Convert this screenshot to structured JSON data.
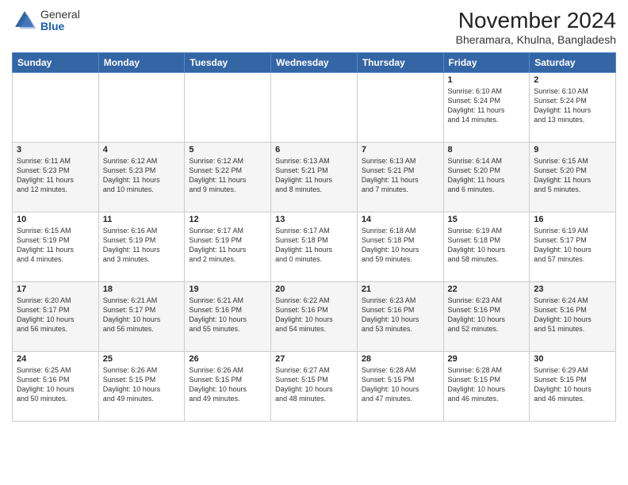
{
  "logo": {
    "general": "General",
    "blue": "Blue"
  },
  "title": "November 2024",
  "subtitle": "Bheramara, Khulna, Bangladesh",
  "weekdays": [
    "Sunday",
    "Monday",
    "Tuesday",
    "Wednesday",
    "Thursday",
    "Friday",
    "Saturday"
  ],
  "weeks": [
    [
      {
        "day": "",
        "info": ""
      },
      {
        "day": "",
        "info": ""
      },
      {
        "day": "",
        "info": ""
      },
      {
        "day": "",
        "info": ""
      },
      {
        "day": "",
        "info": ""
      },
      {
        "day": "1",
        "info": "Sunrise: 6:10 AM\nSunset: 5:24 PM\nDaylight: 11 hours\nand 14 minutes."
      },
      {
        "day": "2",
        "info": "Sunrise: 6:10 AM\nSunset: 5:24 PM\nDaylight: 11 hours\nand 13 minutes."
      }
    ],
    [
      {
        "day": "3",
        "info": "Sunrise: 6:11 AM\nSunset: 5:23 PM\nDaylight: 11 hours\nand 12 minutes."
      },
      {
        "day": "4",
        "info": "Sunrise: 6:12 AM\nSunset: 5:23 PM\nDaylight: 11 hours\nand 10 minutes."
      },
      {
        "day": "5",
        "info": "Sunrise: 6:12 AM\nSunset: 5:22 PM\nDaylight: 11 hours\nand 9 minutes."
      },
      {
        "day": "6",
        "info": "Sunrise: 6:13 AM\nSunset: 5:21 PM\nDaylight: 11 hours\nand 8 minutes."
      },
      {
        "day": "7",
        "info": "Sunrise: 6:13 AM\nSunset: 5:21 PM\nDaylight: 11 hours\nand 7 minutes."
      },
      {
        "day": "8",
        "info": "Sunrise: 6:14 AM\nSunset: 5:20 PM\nDaylight: 11 hours\nand 6 minutes."
      },
      {
        "day": "9",
        "info": "Sunrise: 6:15 AM\nSunset: 5:20 PM\nDaylight: 11 hours\nand 5 minutes."
      }
    ],
    [
      {
        "day": "10",
        "info": "Sunrise: 6:15 AM\nSunset: 5:19 PM\nDaylight: 11 hours\nand 4 minutes."
      },
      {
        "day": "11",
        "info": "Sunrise: 6:16 AM\nSunset: 5:19 PM\nDaylight: 11 hours\nand 3 minutes."
      },
      {
        "day": "12",
        "info": "Sunrise: 6:17 AM\nSunset: 5:19 PM\nDaylight: 11 hours\nand 2 minutes."
      },
      {
        "day": "13",
        "info": "Sunrise: 6:17 AM\nSunset: 5:18 PM\nDaylight: 11 hours\nand 0 minutes."
      },
      {
        "day": "14",
        "info": "Sunrise: 6:18 AM\nSunset: 5:18 PM\nDaylight: 10 hours\nand 59 minutes."
      },
      {
        "day": "15",
        "info": "Sunrise: 6:19 AM\nSunset: 5:18 PM\nDaylight: 10 hours\nand 58 minutes."
      },
      {
        "day": "16",
        "info": "Sunrise: 6:19 AM\nSunset: 5:17 PM\nDaylight: 10 hours\nand 57 minutes."
      }
    ],
    [
      {
        "day": "17",
        "info": "Sunrise: 6:20 AM\nSunset: 5:17 PM\nDaylight: 10 hours\nand 56 minutes."
      },
      {
        "day": "18",
        "info": "Sunrise: 6:21 AM\nSunset: 5:17 PM\nDaylight: 10 hours\nand 56 minutes."
      },
      {
        "day": "19",
        "info": "Sunrise: 6:21 AM\nSunset: 5:16 PM\nDaylight: 10 hours\nand 55 minutes."
      },
      {
        "day": "20",
        "info": "Sunrise: 6:22 AM\nSunset: 5:16 PM\nDaylight: 10 hours\nand 54 minutes."
      },
      {
        "day": "21",
        "info": "Sunrise: 6:23 AM\nSunset: 5:16 PM\nDaylight: 10 hours\nand 53 minutes."
      },
      {
        "day": "22",
        "info": "Sunrise: 6:23 AM\nSunset: 5:16 PM\nDaylight: 10 hours\nand 52 minutes."
      },
      {
        "day": "23",
        "info": "Sunrise: 6:24 AM\nSunset: 5:16 PM\nDaylight: 10 hours\nand 51 minutes."
      }
    ],
    [
      {
        "day": "24",
        "info": "Sunrise: 6:25 AM\nSunset: 5:16 PM\nDaylight: 10 hours\nand 50 minutes."
      },
      {
        "day": "25",
        "info": "Sunrise: 6:26 AM\nSunset: 5:15 PM\nDaylight: 10 hours\nand 49 minutes."
      },
      {
        "day": "26",
        "info": "Sunrise: 6:26 AM\nSunset: 5:15 PM\nDaylight: 10 hours\nand 49 minutes."
      },
      {
        "day": "27",
        "info": "Sunrise: 6:27 AM\nSunset: 5:15 PM\nDaylight: 10 hours\nand 48 minutes."
      },
      {
        "day": "28",
        "info": "Sunrise: 6:28 AM\nSunset: 5:15 PM\nDaylight: 10 hours\nand 47 minutes."
      },
      {
        "day": "29",
        "info": "Sunrise: 6:28 AM\nSunset: 5:15 PM\nDaylight: 10 hours\nand 46 minutes."
      },
      {
        "day": "30",
        "info": "Sunrise: 6:29 AM\nSunset: 5:15 PM\nDaylight: 10 hours\nand 46 minutes."
      }
    ]
  ]
}
